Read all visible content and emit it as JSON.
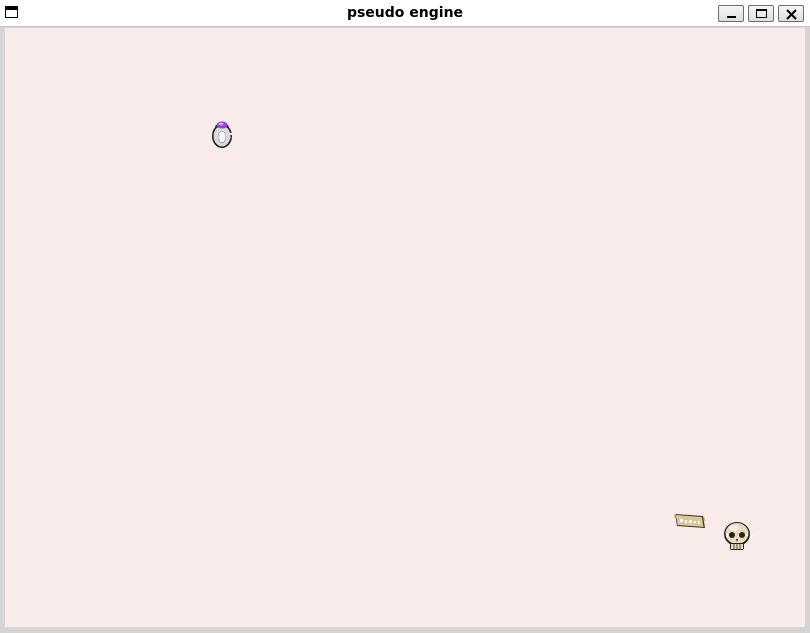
{
  "window": {
    "title": "pseudo engine",
    "buttons": {
      "minimize_icon": "minimize-icon",
      "maximize_icon": "maximize-icon",
      "close_icon": "close-icon"
    }
  },
  "scene": {
    "background": "#f8ebea",
    "entities": [
      {
        "name": "ring",
        "icon": "ring-icon",
        "label": ""
      },
      {
        "name": "scroll",
        "icon": "scroll-icon",
        "label": ""
      },
      {
        "name": "skull",
        "icon": "skull-icon",
        "label": ""
      }
    ]
  },
  "colors": {
    "titlebar": "#ffffff",
    "frame": "#d4d4d4",
    "ring_gem": "#9a3fd6",
    "scroll": "#d9c89a",
    "skull": "#e8dcc0"
  }
}
